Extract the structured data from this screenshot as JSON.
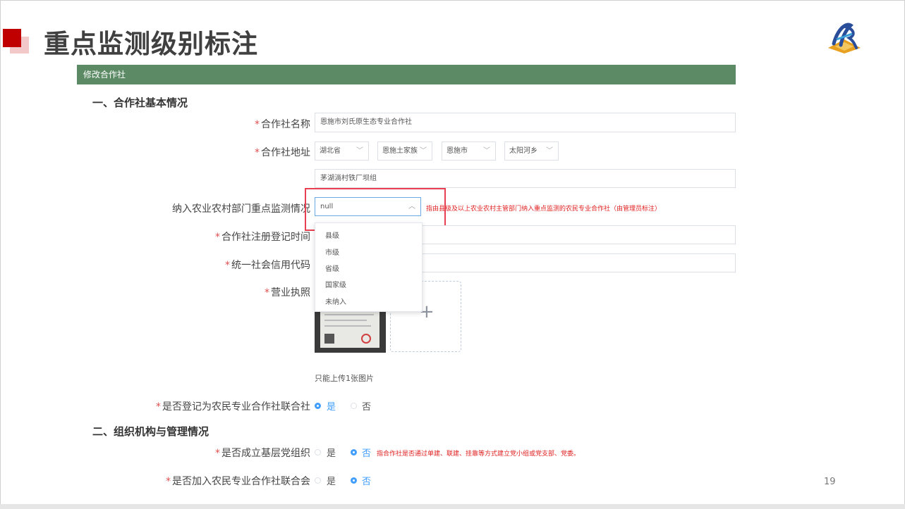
{
  "slide": {
    "title": "重点监测级别标注",
    "page_number": "19"
  },
  "form": {
    "header": "修改合作社",
    "section1_title": "一、合作社基本情况",
    "section2_title": "二、组织机构与管理情况",
    "required_mark": "*",
    "fields": {
      "name": {
        "label": "合作社名称",
        "value": "恩施市刘氏原生态专业合作社"
      },
      "address": {
        "label": "合作社地址",
        "province": "湖北省",
        "prefecture": "恩施土家族",
        "city": "恩施市",
        "township": "太阳河乡",
        "detail": "茅湖淌村铁厂坝组"
      },
      "monitoring": {
        "label": "纳入农业农村部门重点监测情况",
        "value": "null",
        "hint": "指由县级及以上农业农村主管部门纳入重点监测的农民专业合作社（由管理员标注）",
        "options": [
          "县级",
          "市级",
          "省级",
          "国家级",
          "未纳入"
        ]
      },
      "register_time": {
        "label": "合作社注册登记时间"
      },
      "credit_code": {
        "label": "统一社会信用代码"
      },
      "license": {
        "label": "营业执照",
        "note": "只能上传1张图片",
        "add": "+"
      },
      "federation": {
        "label": "是否登记为农民专业合作社联合社",
        "yes": "是",
        "no": "否",
        "selected": "是"
      },
      "party_org": {
        "label": "是否成立基层党组织",
        "yes": "是",
        "no": "否",
        "selected": "否",
        "hint": "指合作社是否通过单建、联建、挂靠等方式建立党小组或党支部、党委。"
      },
      "join_federation": {
        "label": "是否加入农民专业合作社联合会",
        "yes": "是",
        "no": "否",
        "selected": "否"
      }
    }
  },
  "colors": {
    "header_bar": "#5b8a64",
    "accent_blue": "#409eff",
    "required_red": "#e05050",
    "highlight_red": "#e84050",
    "title_red": "#c00000"
  }
}
